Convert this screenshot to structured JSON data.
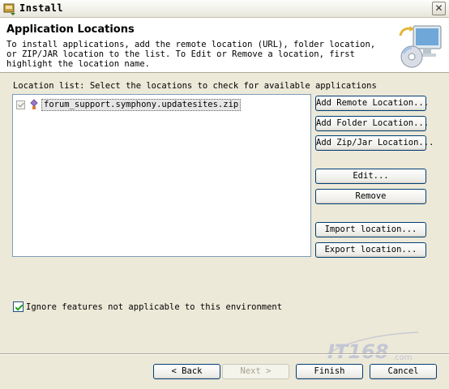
{
  "window": {
    "title": "Install",
    "close_glyph": "✕",
    "icon": "install-wizard-icon"
  },
  "header": {
    "title": "Application Locations",
    "description": "To install applications, add the remote location (URL), folder location, or ZIP/JAR location to the list. To Edit or Remove a location, first highlight the location name.",
    "graphic": "install-computer-cd-icon"
  },
  "location_list": {
    "label": "Location list: Select the locations to check for available applications",
    "items": [
      {
        "text": "forum_support.symphony.updatesites.zip",
        "checked": true,
        "icon": "update-site-icon"
      }
    ]
  },
  "buttons": {
    "add_remote": "Add Remote Location...",
    "add_folder": "Add Folder Location...",
    "add_zip": "Add Zip/Jar Location...",
    "edit": "Edit...",
    "remove": "Remove",
    "import": "Import location...",
    "export": "Export location..."
  },
  "options": {
    "ignore_label": "Ignore features not applicable to this environment",
    "ignore_checked": true
  },
  "nav": {
    "back": "< Back",
    "next": "Next >",
    "finish": "Finish",
    "cancel": "Cancel"
  },
  "watermark": {
    "text": "IT168",
    "subtext": ".com"
  },
  "colors": {
    "dialog_bg": "#ece9d8",
    "header_bg": "#ffffff",
    "button_border": "#003c74",
    "check_green": "#21a121"
  }
}
